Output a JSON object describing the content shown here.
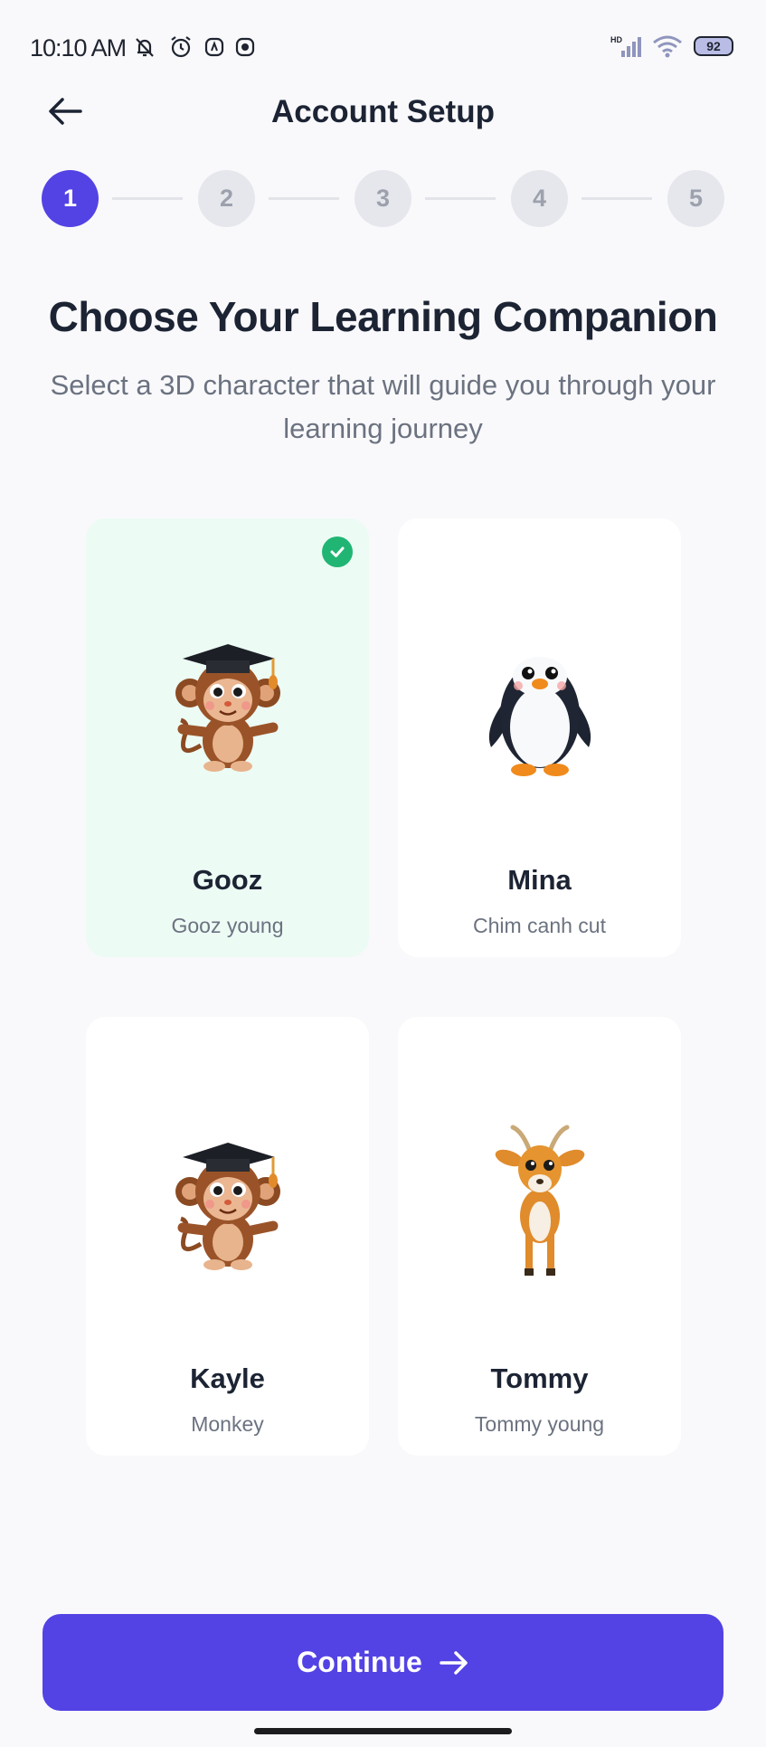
{
  "status_bar": {
    "time": "10:10 AM",
    "battery": "92",
    "network": "HD"
  },
  "header": {
    "title": "Account Setup",
    "back_icon": "arrow-left-icon"
  },
  "stepper": {
    "steps": [
      "1",
      "2",
      "3",
      "4",
      "5"
    ],
    "current": 1
  },
  "main": {
    "title": "Choose Your Learning Companion",
    "subtitle": "Select a 3D character that will guide you through your learning journey"
  },
  "characters": [
    {
      "name": "Gooz",
      "description": "Gooz young",
      "icon": "monkey-graduate-icon",
      "selected": true
    },
    {
      "name": "Mina",
      "description": "Chim canh cut",
      "icon": "penguin-icon",
      "selected": false
    },
    {
      "name": "Kayle",
      "description": "Monkey",
      "icon": "monkey-graduate-icon",
      "selected": false
    },
    {
      "name": "Tommy",
      "description": "Tommy young",
      "icon": "gazelle-icon",
      "selected": false
    }
  ],
  "footer": {
    "continue_label": "Continue"
  },
  "colors": {
    "accent": "#5343e4",
    "selected_bg": "#ecfbf4",
    "check": "#20b573",
    "background": "#f9f9fb"
  }
}
